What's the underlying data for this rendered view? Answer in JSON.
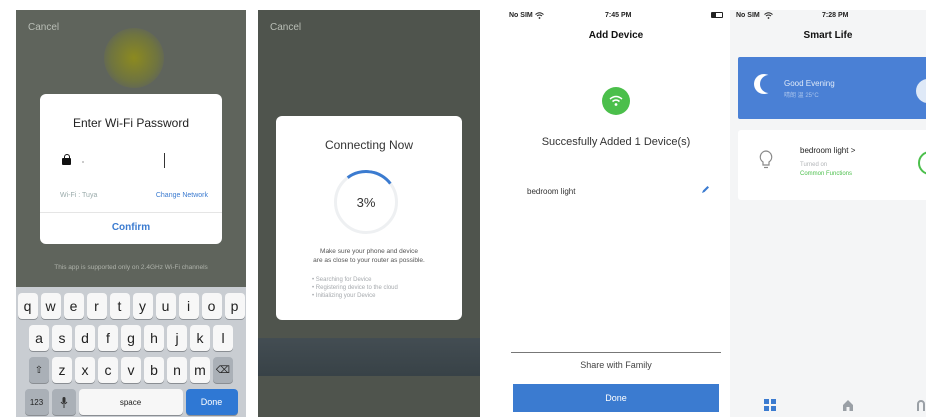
{
  "wifi_screen": {
    "cancel": "Cancel",
    "dialog_title": "Enter Wi-Fi Password",
    "wifi_label": "Wi-Fi : Tuya",
    "change_network": "Change Network",
    "confirm": "Confirm",
    "note": "This app is supported only on 2.4GHz Wi-Fi channels",
    "keyboard": {
      "row1": [
        "q",
        "w",
        "e",
        "r",
        "t",
        "y",
        "u",
        "i",
        "o",
        "p"
      ],
      "row2": [
        "a",
        "s",
        "d",
        "f",
        "g",
        "h",
        "j",
        "k",
        "l"
      ],
      "row3": [
        "z",
        "x",
        "c",
        "v",
        "b",
        "n",
        "m"
      ],
      "num_key": "123",
      "space": "space",
      "done": "Done"
    }
  },
  "connecting_screen": {
    "cancel": "Cancel",
    "title": "Connecting Now",
    "progress": "3%",
    "message_line1": "Make sure your phone and device",
    "message_line2": "are as close to your router as possible.",
    "steps": [
      "Searching for Device",
      "Registering device to the cloud",
      "Initializing your Device"
    ]
  },
  "add_device_screen": {
    "carrier": "No SIM",
    "time": "7:45 PM",
    "title": "Add Device",
    "success": "Succesfully Added 1 Device(s)",
    "device_name": "bedroom light",
    "share": "Share with Family",
    "done": "Done",
    "accent": "#3b7bd0",
    "success_color": "#4bbf4b"
  },
  "smart_life_screen": {
    "carrier": "No SIM",
    "time": "7:28 PM",
    "title": "Smart Life",
    "greeting": "Good Evening",
    "greeting_sub": "晴朗 温 25°C",
    "device_name": "bedroom light >",
    "device_state": "Turned on",
    "device_function": "Common Functions"
  }
}
